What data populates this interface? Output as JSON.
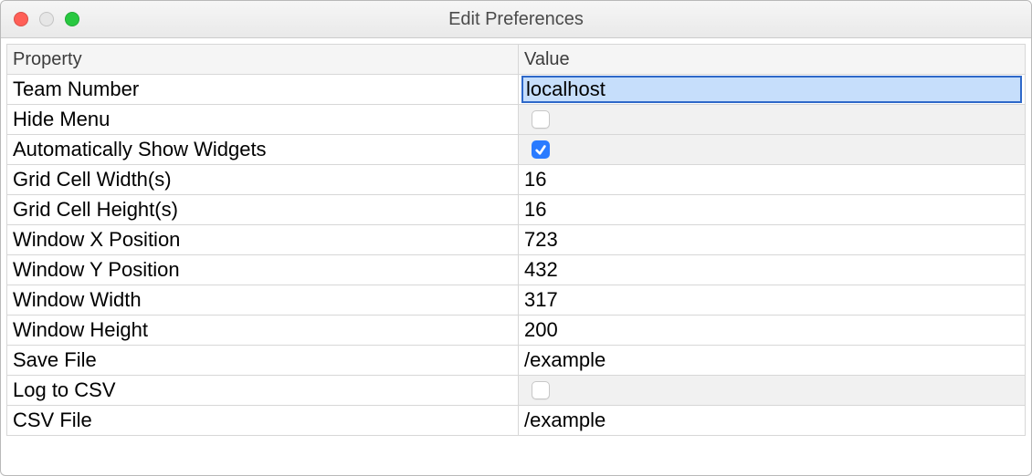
{
  "window": {
    "title": "Edit Preferences"
  },
  "table": {
    "headers": {
      "property": "Property",
      "value": "Value"
    },
    "team_number": {
      "label": "Team Number",
      "value": "localhost",
      "type": "text",
      "editing": true
    },
    "hide_menu": {
      "label": "Hide Menu",
      "value": false,
      "type": "bool"
    },
    "auto_show_widgets": {
      "label": "Automatically Show Widgets",
      "value": true,
      "type": "bool"
    },
    "grid_cell_width": {
      "label": "Grid Cell Width(s)",
      "value": "16",
      "type": "text"
    },
    "grid_cell_height": {
      "label": "Grid Cell Height(s)",
      "value": "16",
      "type": "text"
    },
    "window_x": {
      "label": "Window X Position",
      "value": "723",
      "type": "text"
    },
    "window_y": {
      "label": "Window Y Position",
      "value": "432",
      "type": "text"
    },
    "window_width": {
      "label": "Window Width",
      "value": "317",
      "type": "text"
    },
    "window_height": {
      "label": "Window Height",
      "value": "200",
      "type": "text"
    },
    "save_file": {
      "label": "Save File",
      "value": "/example",
      "type": "text"
    },
    "log_to_csv": {
      "label": "Log to CSV",
      "value": false,
      "type": "bool"
    },
    "csv_file": {
      "label": "CSV File",
      "value": "/example",
      "type": "text"
    }
  }
}
